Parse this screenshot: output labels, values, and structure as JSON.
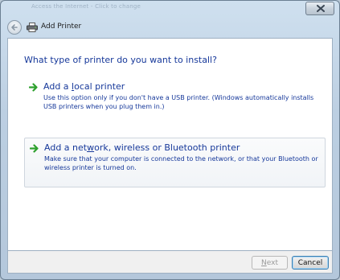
{
  "window": {
    "background_text": "Access the Internet - Click to change",
    "title": "Add Printer"
  },
  "wizard": {
    "question": "What type of printer do you want to install?",
    "options": [
      {
        "title_pre": "Add a ",
        "title_accel": "l",
        "title_post": "ocal printer",
        "description": "Use this option only if you don't have a USB printer. (Windows automatically installs USB printers when you plug them in.)"
      },
      {
        "title_pre": "Add a net",
        "title_accel": "w",
        "title_post": "ork, wireless or Bluetooth printer",
        "description": "Make sure that your computer is connected to the network, or that your Bluetooth or wireless printer is turned on."
      }
    ]
  },
  "footer": {
    "next_pre": "",
    "next_accel": "N",
    "next_post": "ext",
    "cancel_label": "Cancel"
  },
  "icons": {
    "arrow": "green-arrow-icon",
    "printer": "printer-icon",
    "back": "back-arrow-icon",
    "close": "close-icon"
  },
  "colors": {
    "link_blue": "#16389a",
    "arrow_green": "#2ea12e"
  }
}
